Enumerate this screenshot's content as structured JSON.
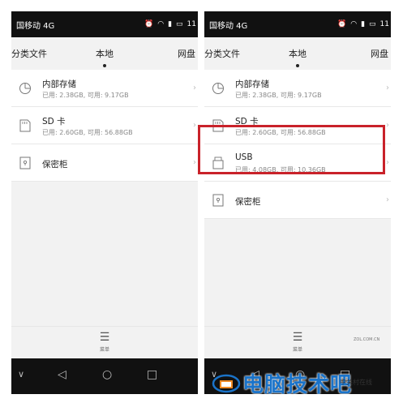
{
  "status": {
    "left_carrier": "国移动 4G",
    "right_carrier": "国移动 4G",
    "time": "11"
  },
  "tabs": {
    "category": "分类文件",
    "local": "本地",
    "cloud": "网盘"
  },
  "left_items": [
    {
      "title": "内部存储",
      "sub": "已用: 2.38GB, 可用: 9.17GB",
      "icon": "pie-chart-icon"
    },
    {
      "title": "SD 卡",
      "sub": "已用: 2.60GB, 可用: 56.88GB",
      "icon": "sd-card-icon"
    },
    {
      "title": "保密柜",
      "sub": "",
      "icon": "safe-icon"
    }
  ],
  "right_items": [
    {
      "title": "内部存储",
      "sub": "已用: 2.38GB, 可用: 9.17GB",
      "icon": "pie-chart-icon"
    },
    {
      "title": "SD 卡",
      "sub": "已用: 2.60GB, 可用: 56.88GB",
      "icon": "sd-card-icon"
    },
    {
      "title": "USB",
      "sub": "已用: 4.08GB, 可用: 10.36GB",
      "icon": "usb-drive-icon"
    },
    {
      "title": "保密柜",
      "sub": "",
      "icon": "safe-icon"
    }
  ],
  "menu": {
    "icon": "hamburger-menu-icon",
    "label": "菜单"
  },
  "nav_icons": [
    "chevron-down-icon",
    "back-triangle-icon",
    "home-circle-icon",
    "recent-apps-square-icon"
  ],
  "watermark": {
    "text": "电脑技术吧",
    "small": "中关村在线",
    "zol": "ZOL.COM.CN"
  },
  "colors": {
    "highlight": "#c9222a",
    "watermark": "#1a73c9"
  }
}
